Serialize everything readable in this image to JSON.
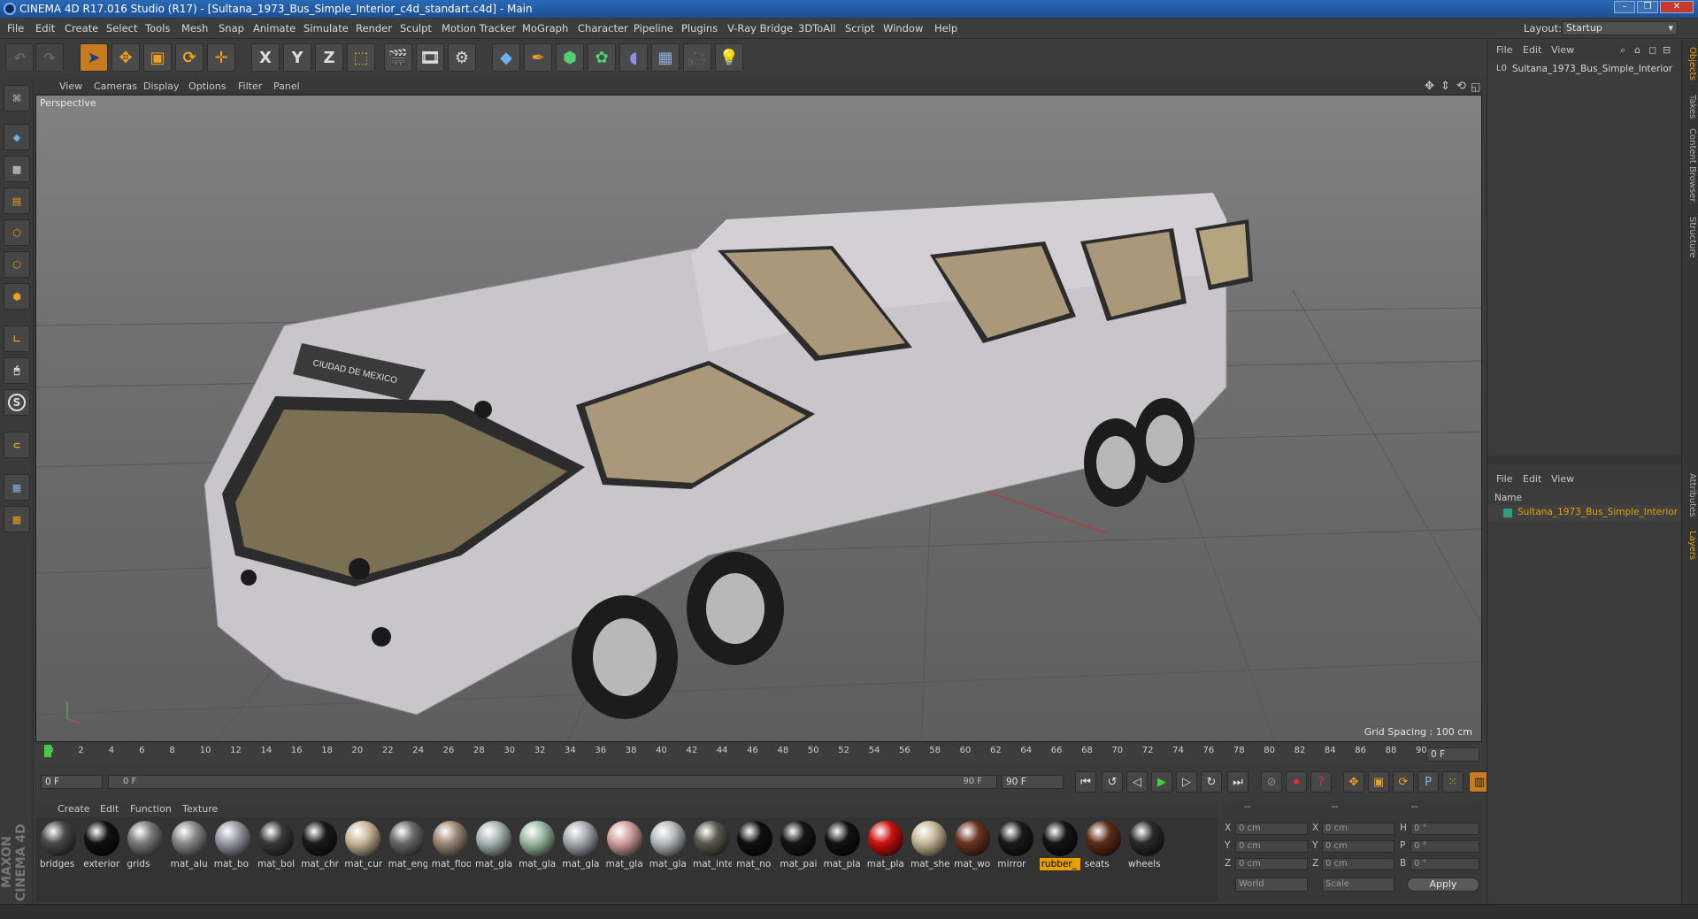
{
  "window": {
    "title": "CINEMA 4D R17.016 Studio (R17) - [Sultana_1973_Bus_Simple_Interior_c4d_standart.c4d] - Main",
    "controls": [
      "–",
      "❐",
      "✕"
    ]
  },
  "menubar": {
    "items": [
      "File",
      "Edit",
      "Create",
      "Select",
      "Tools",
      "Mesh",
      "Snap",
      "Animate",
      "Simulate",
      "Render",
      "Sculpt",
      "Motion Tracker",
      "MoGraph",
      "Character",
      "Pipeline",
      "Plugins",
      "V-Ray Bridge",
      "3DToAll",
      "Script",
      "Window",
      "Help"
    ],
    "layout_label": "Layout:",
    "layout_value": "Startup"
  },
  "toolbar": {
    "axis_x": "X",
    "axis_y": "Y",
    "axis_z": "Z"
  },
  "viewport": {
    "menu": [
      "View",
      "Cameras",
      "Display",
      "Options",
      "Filter",
      "Panel"
    ],
    "label": "Perspective",
    "grid_spacing": "Grid Spacing : 100 cm",
    "bus_sign": "CIUDAD DE MEXICO"
  },
  "timeline": {
    "ticks": [
      "0",
      "2",
      "4",
      "6",
      "8",
      "10",
      "12",
      "14",
      "16",
      "18",
      "20",
      "22",
      "24",
      "26",
      "28",
      "30",
      "32",
      "34",
      "36",
      "38",
      "40",
      "42",
      "44",
      "46",
      "48",
      "50",
      "52",
      "54",
      "56",
      "58",
      "60",
      "62",
      "64",
      "66",
      "68",
      "70",
      "72",
      "74",
      "76",
      "78",
      "80",
      "82",
      "84",
      "86",
      "88",
      "90"
    ],
    "current_frame": "0 F"
  },
  "playback": {
    "start_field": "0 F",
    "range_start": "0 F",
    "range_end": "90 F",
    "end_field": "90 F"
  },
  "material_manager": {
    "menu": [
      "Create",
      "Edit",
      "Function",
      "Texture"
    ],
    "materials": [
      {
        "label": "bridges",
        "color": "#4a4a4a"
      },
      {
        "label": "exterior",
        "color": "#111111"
      },
      {
        "label": "grids",
        "color": "#7a7a7a"
      },
      {
        "label": "mat_alu",
        "color": "#8a8a8a"
      },
      {
        "label": "mat_bo",
        "color": "#9a9aa8"
      },
      {
        "label": "mat_bol",
        "color": "#3a3a3a"
      },
      {
        "label": "mat_chr",
        "color": "#1a1a1a"
      },
      {
        "label": "mat_cur",
        "color": "#cbb89a"
      },
      {
        "label": "mat_eng",
        "color": "#6a6a6a"
      },
      {
        "label": "mat_floo",
        "color": "#9d8a78"
      },
      {
        "label": "mat_gla",
        "color": "#a8b6b4"
      },
      {
        "label": "mat_gla",
        "color": "#9cbca4"
      },
      {
        "label": "mat_gla",
        "color": "#a8acb4"
      },
      {
        "label": "mat_gla",
        "color": "#d4a0a0"
      },
      {
        "label": "mat_gla",
        "color": "#b8bcc0"
      },
      {
        "label": "mat_inte",
        "color": "#5a5a50"
      },
      {
        "label": "mat_no",
        "color": "#101010"
      },
      {
        "label": "mat_pai",
        "color": "#151515"
      },
      {
        "label": "mat_pla",
        "color": "#121212"
      },
      {
        "label": "mat_pla",
        "color": "#cc1111"
      },
      {
        "label": "mat_she",
        "color": "#c9b99a"
      },
      {
        "label": "mat_wo",
        "color": "#6b3322"
      },
      {
        "label": "mirror",
        "color": "#1a1a1a"
      },
      {
        "label": "rubber_",
        "color": "#141414",
        "selected": true
      },
      {
        "label": "seats",
        "color": "#5e2c18"
      },
      {
        "label": "wheels",
        "color": "#2a2a2a"
      }
    ]
  },
  "coordinates": {
    "header": [
      "--",
      "--",
      "--"
    ],
    "rows": [
      {
        "axis": "X",
        "pos": "0 cm",
        "size_axis": "X",
        "size": "0 cm",
        "rot_axis": "H",
        "rot": "0 °"
      },
      {
        "axis": "Y",
        "pos": "0 cm",
        "size_axis": "Y",
        "size": "0 cm",
        "rot_axis": "P",
        "rot": "0 °"
      },
      {
        "axis": "Z",
        "pos": "0 cm",
        "size_axis": "Z",
        "size": "0 cm",
        "rot_axis": "B",
        "rot": "0 °"
      }
    ],
    "mode_world": "World",
    "mode_scale": "Scale",
    "apply": "Apply"
  },
  "object_manager": {
    "menu": [
      "File",
      "Edit",
      "View"
    ],
    "object_name": "Sultana_1973_Bus_Simple_Interior"
  },
  "layer_manager": {
    "menu": [
      "File",
      "Edit",
      "View"
    ],
    "column_name": "Name",
    "layer_name": "Sultana_1973_Bus_Simple_Interior"
  },
  "side_tabs": {
    "top": [
      "Objects",
      "Takes",
      "Content Browser",
      "Structure"
    ],
    "bottom": [
      "Attributes",
      "Layers"
    ]
  },
  "branding": "MAXON CINEMA 4D",
  "colors": {
    "accent": "#e8a000",
    "active_tool": "#c87b1e",
    "title_bar": "#2a6ab7"
  }
}
